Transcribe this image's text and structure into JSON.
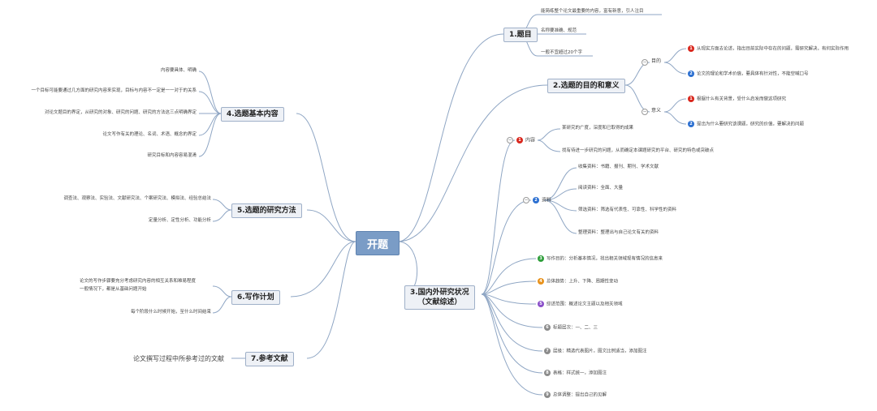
{
  "root": "开题",
  "n1": {
    "title": "1.题目",
    "items": [
      "能简练整个论文最重要的内容，富有新意，引人注目",
      "名称要准确、规范",
      "一般不宜超过20个字"
    ]
  },
  "n2": {
    "title": "2.选题的目的和意义",
    "purpose": {
      "label": "目的",
      "items": [
        "从现实方面去论述，指出目前实际中存在的问题，需研究解决，有何实际作用",
        "论文的理论和学术价值，要具体有针对性，不能空喊口号"
      ]
    },
    "meaning": {
      "label": "意义",
      "items": [
        "根据什么有关背景，受什么启发而做这项研究",
        "提出为什么要研究该课题，研究的价值，要解决的问题"
      ]
    }
  },
  "n3": {
    "title": "3.国内外研究状况",
    "title2": "（文献综述）",
    "content": {
      "label": "内容",
      "items": [
        "某研究的广度，深度和已取得的成果",
        "找有待进一步研究的问题，从而确定本课题研究的平台、研究的特色或突破点"
      ]
    },
    "material": {
      "label": "资料",
      "items": [
        "收集资料：书籍、报刊、期刊、学术文献",
        "阅读资料：全面、大量",
        "筛选资料：筛选有代表性、可靠性、科学性的资料",
        "整理资料：整理出与自己论文有关的资料"
      ]
    },
    "steps": [
      "写作目的：分析基本情况，找出相关领域现有情况的信息来",
      "总体趋势：上升、下降、周期性变动",
      "综述范围：概述论文主题以及相关领域",
      "标题层次：一、二、三",
      "层级：精选代表图片，图文比例适当，添加图注",
      "表格：样式统一，添加图注",
      "总体调整：提出自己的见解"
    ]
  },
  "n4": {
    "title": "4.选题基本内容",
    "items": [
      "内容要具体、明确",
      "一个目标可能要通过几方面的研究内容来实现，目标与内容不一定是一一对于的关系",
      "对论文题目的界定，从研究的对象、研究的问题、研究的方法这三点明确界定",
      "论文写作有关的理论、名词、术语、概念的界定",
      "研究目标和内容容易混淆"
    ]
  },
  "n5": {
    "title": "5.选题的研究方法",
    "items": [
      "调查法、观察法、实验法、文献研究法、个案研究法、模拟法、经验总结法",
      "定量分析、定性分析、功能分析"
    ]
  },
  "n6": {
    "title": "6.写作计划",
    "items": [
      "论文的写作步骤要充分考虑研究内容的相互关系和难易程度",
      "一般情况下，都是从基础问题开始",
      "每个阶段什么时候开始，至什么时间结束"
    ]
  },
  "n7": {
    "title": "7.参考文献",
    "items": [
      "论文撰写过程中所参考过的文献"
    ]
  },
  "colors": {
    "b1": "#d9261c",
    "b2": "#2b6fd1",
    "b3": "#2e9e3a",
    "b4": "#e8921c",
    "b5": "#8a4fc9",
    "b6": "#8c8c8c"
  }
}
